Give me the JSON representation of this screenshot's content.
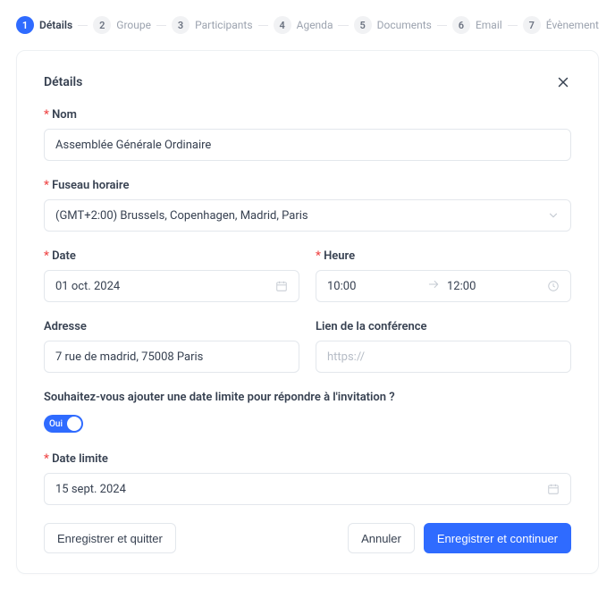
{
  "stepper": {
    "active_index": 0,
    "items": [
      {
        "num": "1",
        "label": "Détails"
      },
      {
        "num": "2",
        "label": "Groupe"
      },
      {
        "num": "3",
        "label": "Participants"
      },
      {
        "num": "4",
        "label": "Agenda"
      },
      {
        "num": "5",
        "label": "Documents"
      },
      {
        "num": "6",
        "label": "Email"
      },
      {
        "num": "7",
        "label": "Évènement"
      }
    ]
  },
  "card": {
    "title": "Détails"
  },
  "fields": {
    "name": {
      "label": "Nom",
      "value": "Assemblée Générale Ordinaire"
    },
    "timezone": {
      "label": "Fuseau horaire",
      "value": "(GMT+2:00) Brussels, Copenhagen, Madrid, Paris"
    },
    "date": {
      "label": "Date",
      "value": "01 oct. 2024"
    },
    "time": {
      "label": "Heure",
      "from": "10:00",
      "to": "12:00"
    },
    "address": {
      "label": "Adresse",
      "value": "7 rue de madrid, 75008 Paris"
    },
    "conference": {
      "label": "Lien de la conférence",
      "placeholder": "https://",
      "value": ""
    },
    "deadline_q": "Souhaitez-vous ajouter une date limite pour répondre à l'invitation ?",
    "deadline_toggle": {
      "state": "on",
      "label": "Oui"
    },
    "deadline": {
      "label": "Date limite",
      "value": "15 sept. 2024"
    }
  },
  "buttons": {
    "save_quit": "Enregistrer et quitter",
    "cancel": "Annuler",
    "save_continue": "Enregistrer et continuer"
  }
}
